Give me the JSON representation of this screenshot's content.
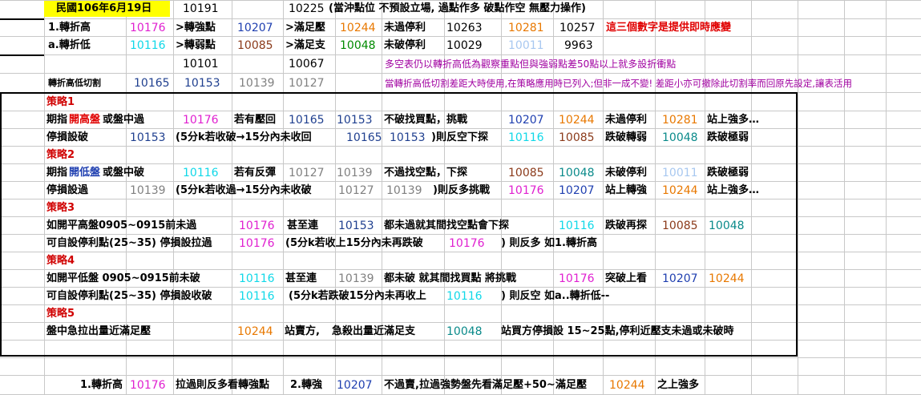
{
  "colors": {
    "accent_yellow": "#ffff00",
    "red": "#e00000",
    "magenta": "#e020d0",
    "blue": "#1f3fb0",
    "orange": "#e87800",
    "green": "#008a00",
    "cyan": "#10d8e8",
    "light_blue": "#a8c8f0",
    "brown": "#8b3a1a",
    "gray": "#808080",
    "teal": "#0a8a8a",
    "purple": "#a000a0"
  },
  "r1": {
    "date": "民國106年6月19日",
    "v1": "10191",
    "v2": "10225",
    "note": "(當沖點位 不預設立場, 過點作多 破點作空 無壓力操作)"
  },
  "r2": {
    "label": "1.轉折高",
    "v1": "10176",
    "l2": ">轉強點",
    "v2": "10207",
    "l3": ">滿足壓",
    "v3": "10244",
    "l4": "未過停利",
    "v4": "10263",
    "v5": "10281",
    "v6": "10257",
    "note": "這三個數字是提供即時應變"
  },
  "r3": {
    "label": "a.轉折低",
    "v1": "10116",
    "l2": ">轉弱點",
    "v2": "10085",
    "l3": ">滿足支",
    "v3": "10048",
    "l4": "未破停利",
    "v4": "10029",
    "v5": "10011",
    "v6": "9963"
  },
  "r4": {
    "v1": "10101",
    "v2": "10067",
    "note": "多空表仍以轉折高低為觀察重點但與強弱點差50點以上就多設折衝點"
  },
  "r5": {
    "label": "轉折高低切割",
    "v1": "10165",
    "v2": "10153",
    "v3": "10139",
    "v4": "10127",
    "note": "當轉折高低切割差距大時使用,在策略應用時已列入;但非一成不變! 差距小亦可撤除此切割率而回原先設定,讓表活用"
  },
  "s1": {
    "title": "策略1",
    "a": {
      "t1": "期指",
      "t2": "開高盤",
      "t3": "或盤中過",
      "v1": "10176",
      "t4": "若有壓回",
      "v2": "10165",
      "v3": "10153",
      "t5": "不破找買點，挑戰",
      "v4": "10207",
      "v5": "10244",
      "t6": "未過停利",
      "v6": "10281",
      "t7": "站上強多…"
    },
    "b": {
      "t1": "停損設破",
      "v1": "10153",
      "t2": "(5分k若收破→15分內未收回",
      "v2": "10165",
      "v3": "10153",
      "t3": ")則反空下探",
      "v4": "10116",
      "v5": "10085",
      "t4": "跌破轉弱",
      "v6": "10048",
      "t5": "跌破極弱"
    }
  },
  "s2": {
    "title": "策略2",
    "a": {
      "t1": "期指",
      "t2": "開低盤",
      "t3": "或盤中破",
      "v1": "10116",
      "t4": "若有反彈",
      "v2": "10127",
      "v3": "10139",
      "t5": "不過找空點，下探",
      "v4": "10085",
      "v5": "10048",
      "t6": "未破停利",
      "v6": "10011",
      "t7": "跌破極弱"
    },
    "b": {
      "t1": "停損設過",
      "v1": "10139",
      "t2": "(5分k若收過→15分內未收破",
      "v2": "10127",
      "v3": "10139",
      "t3": ")則反多挑戰",
      "v4": "10176",
      "v5": "10207",
      "t4": "站上轉強",
      "v6": "10244",
      "t5": "站上強多…"
    }
  },
  "s3": {
    "title": "策略3",
    "a": {
      "t1": "如開平高盤0905~0915前未過",
      "v1": "10176",
      "t2": "甚至連",
      "v2": "10153",
      "t3": "都未過就其間找空點會下探",
      "v3": "10116",
      "t4": "跌破再探",
      "v4": "10085",
      "v5": "10048"
    },
    "b": {
      "t1": "可自設停利點(25~35) 停損設拉過",
      "v1": "10176",
      "t2": "(5分k若收上15分內未再跌破",
      "v2": "10176",
      "t3": ") 則反多 如1.轉折高"
    }
  },
  "s4": {
    "title": "策略4",
    "a": {
      "t1": "如開平低盤 0905~0915前未破",
      "v1": "10116",
      "t2": "甚至連",
      "v2": "10139",
      "t3": "都未破 就其間找買點 將挑戰",
      "v3": "10176",
      "t4": "突破上看",
      "v4": "10207",
      "v5": "10244"
    },
    "b": {
      "t1": "可自設停利點(25~35) 停損設收破",
      "v1": "10116",
      "t2": "(5分k若跌破15分內未再收上",
      "v2": "10116",
      "t3": ") 則反空 如a..轉折低--"
    }
  },
  "s5": {
    "title": "策略5",
    "a": {
      "t1": "盤中急拉出量近滿足壓",
      "v1": "10244",
      "t2": "站賣方,",
      "t3": "急殺出量近滿足支",
      "v2": "10048",
      "t4": "站買方停損設 15~25點,停利近壓支未過或未破時"
    }
  },
  "bottom": {
    "t1": "1.轉折高",
    "v1": "10176",
    "t2": "拉過則反多看轉強點",
    "t3": "2.轉強",
    "v2": "10207",
    "t4": "不過賣,拉過強勢盤先看滿足壓+50~",
    "t5": "滿足壓",
    "v3": "10244",
    "t6": "之上強多"
  }
}
